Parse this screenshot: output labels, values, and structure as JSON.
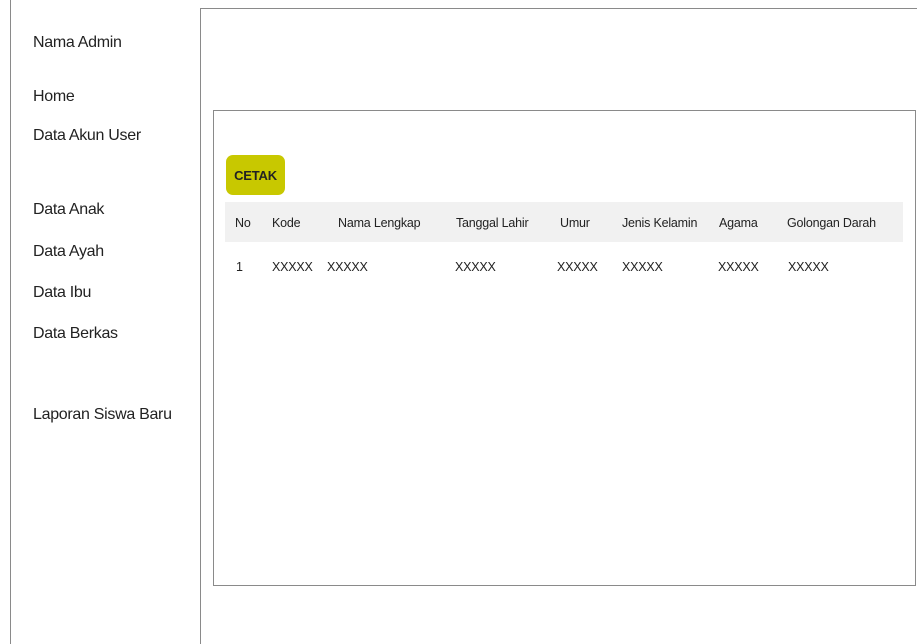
{
  "sidebar": {
    "items": [
      {
        "label": "Nama Admin"
      },
      {
        "label": "Home"
      },
      {
        "label": "Data Akun User"
      },
      {
        "label": "Data Anak"
      },
      {
        "label": "Data Ayah"
      },
      {
        "label": "Data Ibu"
      },
      {
        "label": "Data Berkas"
      },
      {
        "label": "Laporan Siswa Baru"
      }
    ]
  },
  "main": {
    "print_button_label": "CETAK",
    "table": {
      "columns": [
        "No",
        "Kode",
        "Nama Lengkap",
        "Tanggal Lahir",
        "Umur",
        "Jenis Kelamin",
        "Agama",
        "Golongan Darah"
      ],
      "rows": [
        [
          "1",
          "XXXXX",
          "XXXXX",
          "XXXXX",
          "XXXXX",
          "XXXXX",
          "XXXXX",
          "XXXXX"
        ]
      ]
    }
  },
  "colors": {
    "button": "#c8c800",
    "header_bg": "#f1f1f1",
    "border": "#8a8a8a"
  }
}
